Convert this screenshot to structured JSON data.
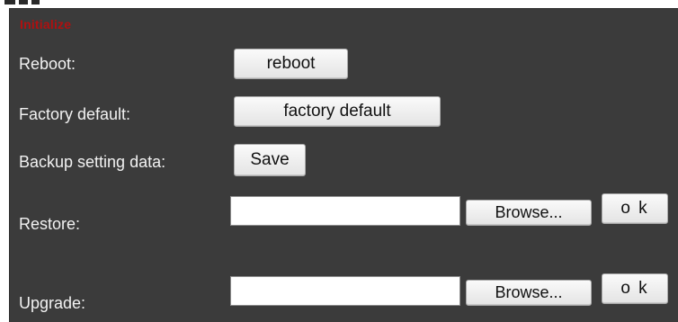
{
  "section": {
    "title": "Initialize"
  },
  "rows": {
    "reboot": {
      "label": "Reboot:",
      "button": "reboot"
    },
    "factory_default": {
      "label": "Factory default:",
      "button": "factory default"
    },
    "backup": {
      "label": "Backup setting data:",
      "button": "Save"
    },
    "restore": {
      "label": "Restore:",
      "browse": "Browse...",
      "ok": "o k",
      "file_value": ""
    },
    "upgrade": {
      "label": "Upgrade:",
      "browse": "Browse...",
      "ok": "o k",
      "file_value": ""
    }
  },
  "colors": {
    "panel_bg": "#3b3b3b",
    "title_red": "#b01010",
    "label_text": "#f2f2f2"
  }
}
